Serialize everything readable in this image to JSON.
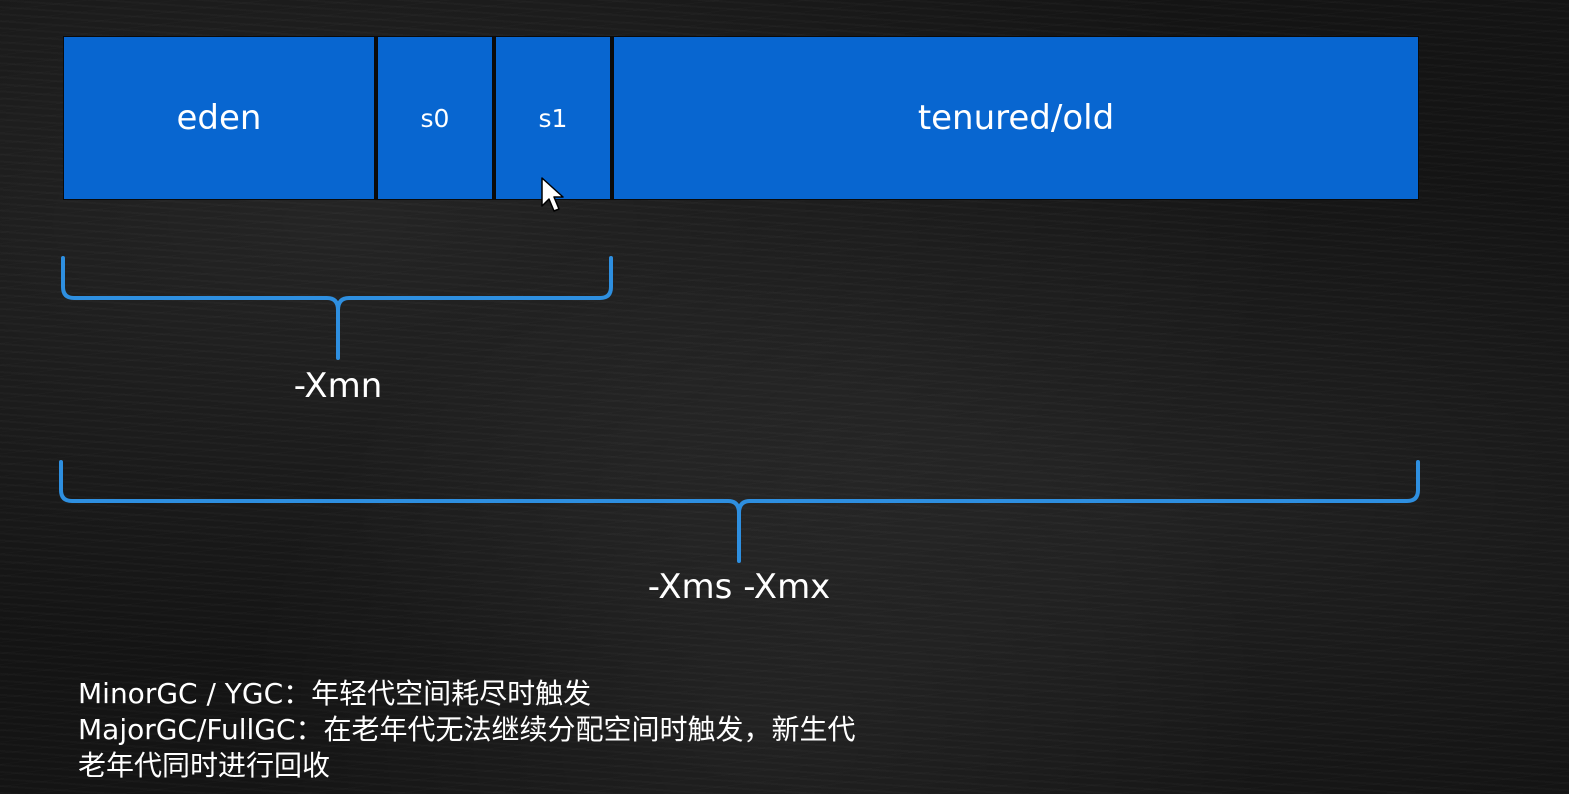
{
  "heap": {
    "regions": [
      {
        "key": "eden",
        "label": "eden"
      },
      {
        "key": "s0",
        "label": "s0"
      },
      {
        "key": "s1",
        "label": "s1"
      },
      {
        "key": "old",
        "label": "tenured/old"
      }
    ]
  },
  "braces": {
    "young": {
      "label": "-Xmn"
    },
    "heap": {
      "label": "-Xms -Xmx"
    }
  },
  "notes": [
    "MinorGC / YGC：年轻代空间耗尽时触发",
    "MajorGC/FullGC：在老年代无法继续分配空间时触发，新生代",
    "老年代同时进行回收"
  ],
  "colors": {
    "region_fill": "#0866d0",
    "brace": "#2e8fe0",
    "text": "#ffffff",
    "background": "#141414"
  },
  "icons": {
    "cursor": "mouse-pointer-icon"
  }
}
